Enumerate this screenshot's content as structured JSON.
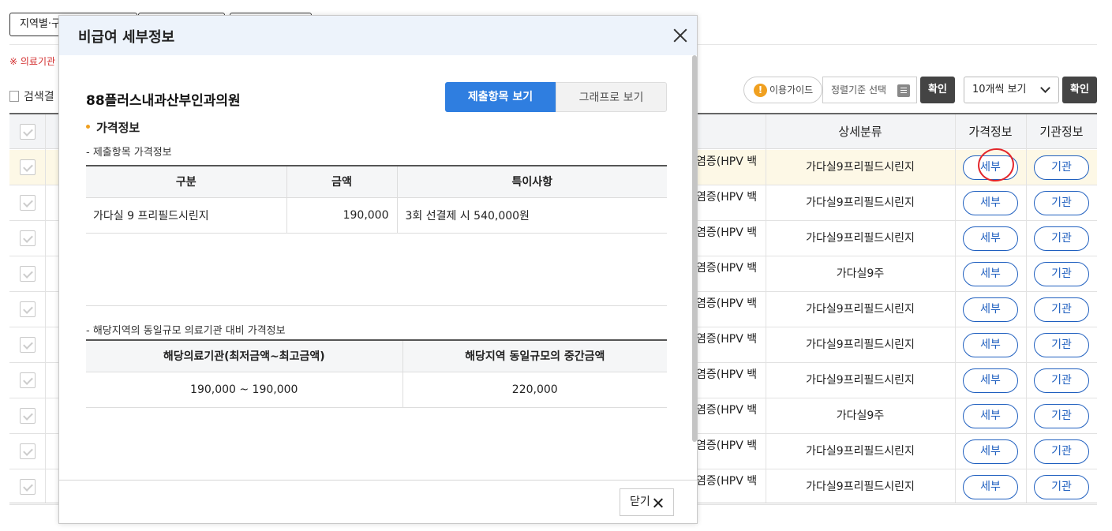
{
  "page": {
    "filter_region": "지역별·구",
    "notice": "※ 의료기관",
    "results_label": "검색결",
    "guide_label": "이용가이드",
    "sort_placeholder": "정렬기준 선택",
    "confirm1": "확인",
    "count_select": "10개씩 보기",
    "confirm2": "확인",
    "col_detail": "상세분류",
    "col_price": "가격정보",
    "col_inst": "기관정보",
    "price_btn": "세부",
    "inst_btn": "기관",
    "rows": [
      {
        "cond": "염증(HPV 백",
        "detail": "가다실9프리필드시린지"
      },
      {
        "cond": "염증(HPV 백",
        "detail": "가다실9프리필드시린지"
      },
      {
        "cond": "염증(HPV 백",
        "detail": "가다실9프리필드시린지"
      },
      {
        "cond": "염증(HPV 백",
        "detail": "가다실9주"
      },
      {
        "cond": "염증(HPV 백",
        "detail": "가다실9프리필드시린지"
      },
      {
        "cond": "염증(HPV 백",
        "detail": "가다실9프리필드시린지"
      },
      {
        "cond": "염증(HPV 백",
        "detail": "가다실9프리필드시린지"
      },
      {
        "cond": "염증(HPV 백",
        "detail": "가다실9주"
      },
      {
        "cond": "염증(HPV 백",
        "detail": "가다실9프리필드시린지"
      },
      {
        "cond": "염증(HPV 백",
        "detail": "가다실9프리필드시린지"
      }
    ]
  },
  "modal": {
    "title": "비급여 세부정보",
    "hospital": "88플러스내과산부인과의원",
    "tab_items": "제출항목 보기",
    "tab_graph": "그래프로 보기",
    "section": "가격정보",
    "sub1": "- 제출항목 가격정보",
    "t1_headers": [
      "구분",
      "금액",
      "특이사항"
    ],
    "t1_row": [
      "가다실 9 프리필드시린지",
      "190,000",
      "3회 선결제 시 540,000원"
    ],
    "sub2": "- 해당지역의 동일규모 의료기관 대비 가격정보",
    "t2_headers": [
      "해당의료기관(최저금액~최고금액)",
      "해당지역 동일규모의 중간금액"
    ],
    "t2_row": [
      "190,000 ~ 190,000",
      "220,000"
    ],
    "close_label": "닫기"
  }
}
